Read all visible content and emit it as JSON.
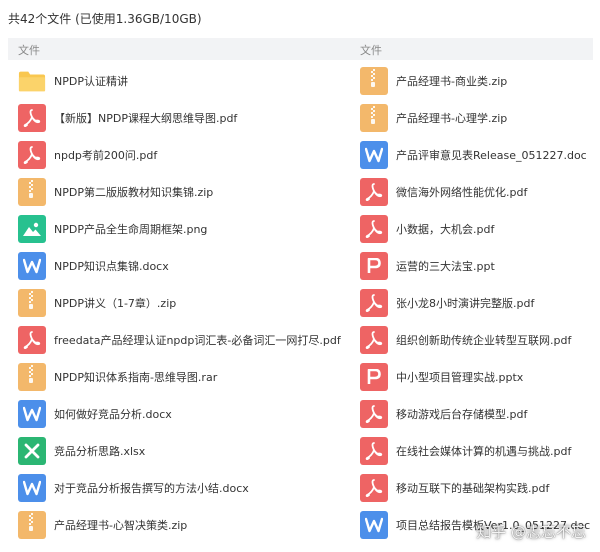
{
  "summary": "共42个文件 (已使用1.36GB/10GB)",
  "header": {
    "left": "文件",
    "right": "文件"
  },
  "colors": {
    "folder": "#F9C74F",
    "zip": "#F3B86B",
    "pdf": "#EE6464",
    "doc": "#4C8FEA",
    "png": "#27C18F",
    "xlsx": "#2BB673",
    "ppt": "#EE6464"
  },
  "left_files": [
    {
      "name": "NPDP认证精讲",
      "type": "folder",
      "icon": "folder-icon"
    },
    {
      "name": "【新版】NPDP课程大纲思维导图.pdf",
      "type": "pdf",
      "icon": "pdf-icon"
    },
    {
      "name": "npdp考前200问.pdf",
      "type": "pdf",
      "icon": "pdf-icon"
    },
    {
      "name": "NPDP第二版版教材知识集锦.zip",
      "type": "zip",
      "icon": "zip-icon"
    },
    {
      "name": "NPDP产品全生命周期框架.png",
      "type": "png",
      "icon": "image-icon"
    },
    {
      "name": "NPDP知识点集锦.docx",
      "type": "doc",
      "icon": "word-icon"
    },
    {
      "name": "NPDP讲义（1-7章）.zip",
      "type": "zip",
      "icon": "zip-icon"
    },
    {
      "name": "freedata产品经理认证npdp词汇表-必备词汇一网打尽.pdf",
      "type": "pdf",
      "icon": "pdf-icon"
    },
    {
      "name": "NPDP知识体系指南-思维导图.rar",
      "type": "zip",
      "icon": "zip-icon"
    },
    {
      "name": "如何做好竞品分析.docx",
      "type": "doc",
      "icon": "word-icon"
    },
    {
      "name": "竞品分析思路.xlsx",
      "type": "xlsx",
      "icon": "excel-icon"
    },
    {
      "name": "对于竞品分析报告撰写的方法小结.docx",
      "type": "doc",
      "icon": "word-icon"
    },
    {
      "name": "产品经理书-心智决策类.zip",
      "type": "zip",
      "icon": "zip-icon"
    }
  ],
  "right_files": [
    {
      "name": "产品经理书-商业类.zip",
      "type": "zip",
      "icon": "zip-icon"
    },
    {
      "name": "产品经理书-心理学.zip",
      "type": "zip",
      "icon": "zip-icon"
    },
    {
      "name": "产品评审意见表Release_051227.doc",
      "type": "doc",
      "icon": "word-icon"
    },
    {
      "name": "微信海外网络性能优化.pdf",
      "type": "pdf",
      "icon": "pdf-icon"
    },
    {
      "name": "小数据，大机会.pdf",
      "type": "pdf",
      "icon": "pdf-icon"
    },
    {
      "name": "运营的三大法宝.ppt",
      "type": "ppt",
      "icon": "ppt-icon"
    },
    {
      "name": "张小龙8小时演讲完整版.pdf",
      "type": "pdf",
      "icon": "pdf-icon"
    },
    {
      "name": "组织创新助传统企业转型互联网.pdf",
      "type": "pdf",
      "icon": "pdf-icon"
    },
    {
      "name": "中小型项目管理实战.pptx",
      "type": "ppt",
      "icon": "ppt-icon"
    },
    {
      "name": "移动游戏后台存储模型.pdf",
      "type": "pdf",
      "icon": "pdf-icon"
    },
    {
      "name": "在线社会媒体计算的机遇与挑战.pdf",
      "type": "pdf",
      "icon": "pdf-icon"
    },
    {
      "name": "移动互联下的基础架构实践.pdf",
      "type": "pdf",
      "icon": "pdf-icon"
    },
    {
      "name": "项目总结报告模板Ver1.0_051227.doc",
      "type": "doc",
      "icon": "word-icon"
    }
  ],
  "watermark": "知乎 @志忘不忘"
}
